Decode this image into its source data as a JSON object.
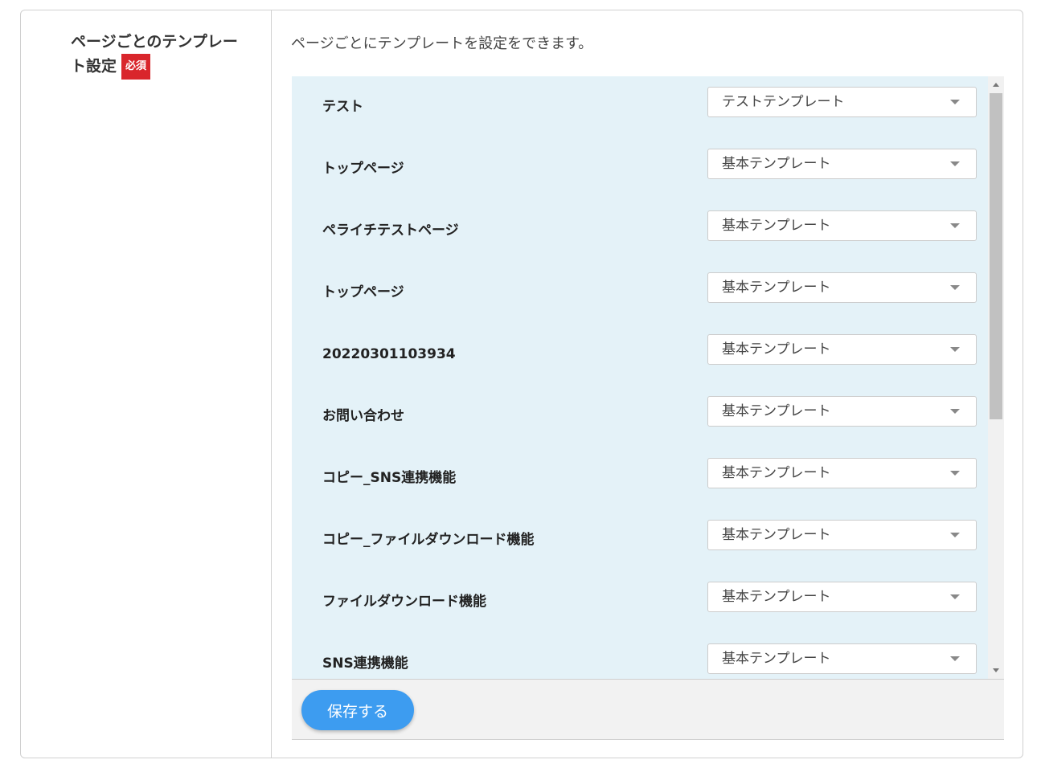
{
  "field": {
    "label": "ページごとのテンプレート設定",
    "required_badge": "必須"
  },
  "description": "ページごとにテンプレートを設定をできます。",
  "rows": [
    {
      "page": "テスト",
      "template": "テストテンプレート"
    },
    {
      "page": "トップページ",
      "template": "基本テンプレート"
    },
    {
      "page": "ペライチテストページ",
      "template": "基本テンプレート"
    },
    {
      "page": "トップページ",
      "template": "基本テンプレート"
    },
    {
      "page": "20220301103934",
      "template": "基本テンプレート"
    },
    {
      "page": "お問い合わせ",
      "template": "基本テンプレート"
    },
    {
      "page": "コピー_SNS連携機能",
      "template": "基本テンプレート"
    },
    {
      "page": "コピー_ファイルダウンロード機能",
      "template": "基本テンプレート"
    },
    {
      "page": "ファイルダウンロード機能",
      "template": "基本テンプレート"
    },
    {
      "page": "SNS連携機能",
      "template": "基本テンプレート"
    }
  ],
  "save_button": "保存する",
  "colors": {
    "list_background": "#e4f2f8",
    "required_badge": "#d9262c",
    "save_button": "#3d9cf0"
  },
  "icons": {
    "select_arrow": "chevron-down-icon",
    "scroll_up": "scroll-up-arrow-icon",
    "scroll_down": "scroll-down-arrow-icon"
  }
}
